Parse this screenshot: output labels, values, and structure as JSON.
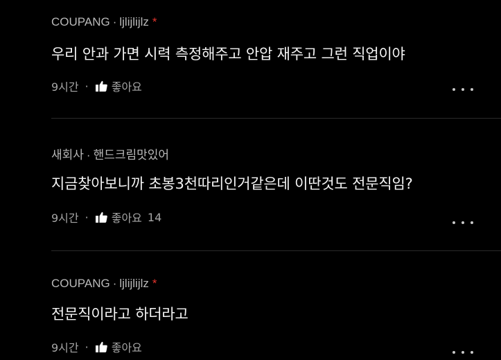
{
  "comments": [
    {
      "company": "COUPANG",
      "separator": "·",
      "username": "ljlijlijlz",
      "badge": "*",
      "text": "우리 안과 가면 시력 측정해주고 안압 재주고 그런 직업이야",
      "time": "9시간",
      "dot": "·",
      "like_label": "좋아요",
      "like_count": ""
    },
    {
      "company": "새회사",
      "separator": "·",
      "username": "핸드크림맛있어",
      "badge": "",
      "text": "지금찾아보니까 초봉3천따리인거같은데 이딴것도 전문직임?",
      "time": "9시간",
      "dot": "·",
      "like_label": "좋아요",
      "like_count": "14"
    },
    {
      "company": "COUPANG",
      "separator": "·",
      "username": "ljlijlijlz",
      "badge": "*",
      "text": "전문직이라고 하더라고",
      "time": "9시간",
      "dot": "·",
      "like_label": "좋아요",
      "like_count": ""
    }
  ],
  "icons": {
    "like": "thumbs-up-icon",
    "more": "more-horizontal-icon"
  },
  "colors": {
    "background": "#000000",
    "meta_text": "#b9b9b9",
    "body_text": "#f4f4f4",
    "badge": "#e2342c",
    "footer_text": "#a6a6a6"
  }
}
